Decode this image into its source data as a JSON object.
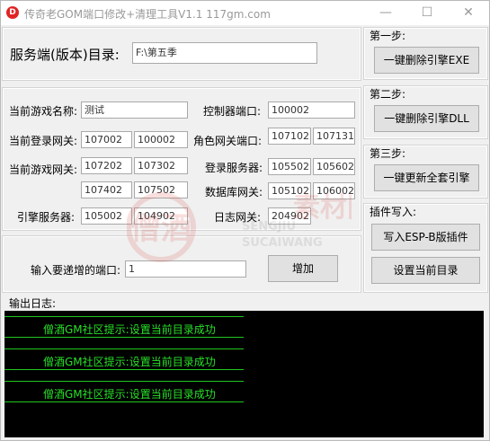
{
  "window": {
    "title": "传奇老GOM端口修改+清理工具V1.1    117gm.com",
    "minimize_glyph": "—",
    "maximize_glyph": "☐",
    "close_glyph": "✕"
  },
  "server_dir": {
    "label": "服务端(版本)目录:",
    "value": "F:\\第五季"
  },
  "game_name": {
    "label": "当前游戏名称:",
    "value": "测试"
  },
  "controller_port": {
    "label": "控制器端口:",
    "value": "100002"
  },
  "login_gateway": {
    "label": "当前登录网关:",
    "values": [
      "107002",
      "100002"
    ]
  },
  "role_gateway": {
    "label": "角色网关端口:",
    "values": [
      "107102",
      "107131"
    ]
  },
  "game_gateway": {
    "label": "当前游戏网关:",
    "values": [
      "107202",
      "107302",
      "107402",
      "107502"
    ]
  },
  "login_server": {
    "label": "登录服务器:",
    "values": [
      "105502",
      "105602"
    ]
  },
  "db_gateway": {
    "label": "数据库网关:",
    "values": [
      "105102",
      "106002"
    ]
  },
  "engine_server": {
    "label": "引擎服务器:",
    "values": [
      "105002",
      "104902"
    ]
  },
  "log_gateway": {
    "label": "日志网关:",
    "value": "204902"
  },
  "increment": {
    "label": "输入要递增的端口:",
    "value": "1",
    "button": "增加"
  },
  "steps": {
    "step1": {
      "title": "第一步:",
      "button": "一键删除引擎EXE"
    },
    "step2": {
      "title": "第二步:",
      "button": "一键删除引擎DLL"
    },
    "step3": {
      "title": "第三步:",
      "button": "一键更新全套引擎"
    },
    "plugin": {
      "title": "插件写入:",
      "button": "写入ESP-B版插件",
      "set_dir_button": "设置当前目录"
    }
  },
  "log": {
    "title": "输出日志:",
    "lines": [
      "僧酒GM社区提示:设置当前目录成功",
      "僧酒GM社区提示:设置当前目录成功",
      "僧酒GM社区提示:设置当前目录成功"
    ]
  },
  "watermark": {
    "text1": "僧酒",
    "text2": "SENGJIU",
    "text3": "SUCAIWANG",
    "text4": "素材网"
  },
  "colors": {
    "log_bg": "#000000",
    "log_text": "#28e028",
    "watermark": "#d9534f"
  }
}
